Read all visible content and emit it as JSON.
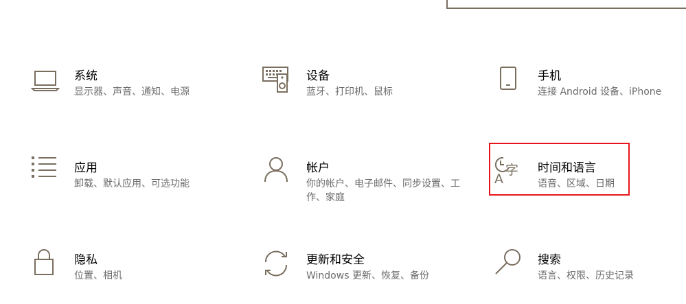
{
  "tiles": [
    {
      "id": "system",
      "icon": "laptop-icon",
      "title": "系统",
      "desc": "显示器、声音、通知、电源"
    },
    {
      "id": "devices",
      "icon": "keyboard-speaker-icon",
      "title": "设备",
      "desc": "蓝牙、打印机、鼠标"
    },
    {
      "id": "phone",
      "icon": "phone-icon",
      "title": "手机",
      "desc": "连接 Android 设备、iPhone"
    },
    {
      "id": "apps",
      "icon": "apps-list-icon",
      "title": "应用",
      "desc": "卸载、默认应用、可选功能"
    },
    {
      "id": "accounts",
      "icon": "person-icon",
      "title": "帐户",
      "desc": "你的帐户、电子邮件、同步设置、工作、家庭"
    },
    {
      "id": "time-language",
      "icon": "time-language-icon",
      "title": "时间和语言",
      "desc": "语音、区域、日期"
    },
    {
      "id": "privacy",
      "icon": "lock-icon",
      "title": "隐私",
      "desc": "位置、相机"
    },
    {
      "id": "update-security",
      "icon": "sync-icon",
      "title": "更新和安全",
      "desc": "Windows 更新、恢复、备份"
    },
    {
      "id": "search",
      "icon": "magnifier-icon",
      "title": "搜索",
      "desc": "语言、权限、历史记录"
    }
  ],
  "highlight_color": "#e8141b",
  "icon_color": "#7a6e5f"
}
